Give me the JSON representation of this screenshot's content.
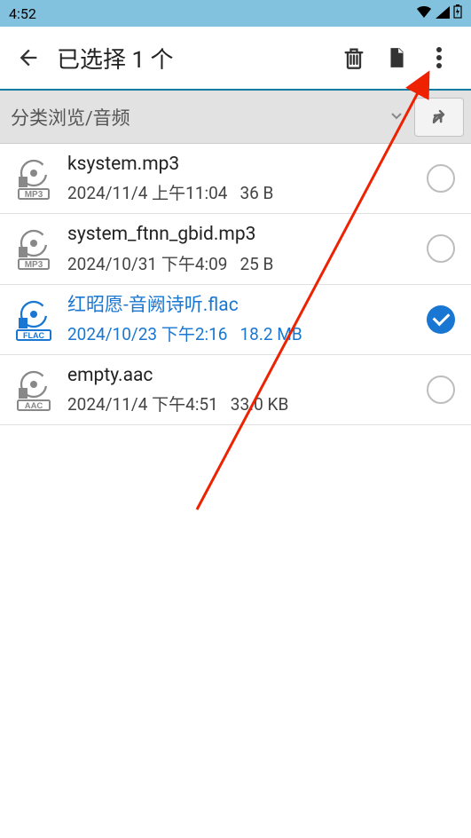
{
  "status": {
    "time": "4:52"
  },
  "toolbar": {
    "title": "已选择 1 个"
  },
  "breadcrumb": {
    "path": "分类浏览/音频"
  },
  "files": [
    {
      "name": "ksystem.mp3",
      "meta1": "2024/11/4 上午11:04",
      "meta2": "36 B",
      "fmt": "MP3",
      "selected": false
    },
    {
      "name": "system_ftnn_gbid.mp3",
      "meta1": "2024/10/31 下午4:09",
      "meta2": "25 B",
      "fmt": "MP3",
      "selected": false
    },
    {
      "name": "红昭愿-音阙诗听.flac",
      "meta1": "2024/10/23 下午2:16",
      "meta2": "18.2 MB",
      "fmt": "FLAC",
      "selected": true
    },
    {
      "name": "empty.aac",
      "meta1": "2024/11/4 下午4:51",
      "meta2": "33.0 KB",
      "fmt": "AAC",
      "selected": false
    }
  ]
}
